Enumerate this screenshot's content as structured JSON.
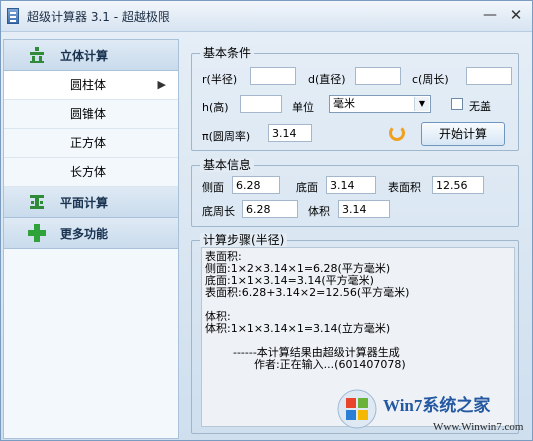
{
  "window": {
    "title": "超级计算器 3.1 - 超越极限",
    "minimize_label": "—",
    "close_label": "✕"
  },
  "sidebar": {
    "sections": [
      {
        "label": "立体计算",
        "icon": "solid-geometry-icon"
      },
      {
        "label": "平面计算",
        "icon": "plane-geometry-icon"
      },
      {
        "label": "更多功能",
        "icon": "plus-icon"
      }
    ],
    "items": [
      {
        "label": "圆柱体",
        "arrow": "▶"
      },
      {
        "label": "圆锥体"
      },
      {
        "label": "正方体"
      },
      {
        "label": "长方体"
      }
    ]
  },
  "basic_conditions": {
    "title": "基本条件",
    "radius_label": "r(半径)",
    "radius_value": "",
    "diameter_label": "d(直径)",
    "diameter_value": "",
    "circumference_label": "c(周长)",
    "circumference_value": "",
    "height_label": "h(高)",
    "height_value": "",
    "unit_label": "单位",
    "unit_value": "毫米",
    "no_lid_label": "无盖",
    "no_lid_checked": false,
    "pi_label": "π(圆周率)",
    "pi_value": "3.14",
    "start_button": "开始计算"
  },
  "basic_info": {
    "title": "基本信息",
    "side_label": "侧面",
    "side_value": "6.28",
    "base_label": "底面",
    "base_value": "3.14",
    "surface_label": "表面积",
    "surface_value": "12.56",
    "base_perimeter_label": "底周长",
    "base_perimeter_value": "6.28",
    "volume_label": "体积",
    "volume_value": "3.14"
  },
  "steps": {
    "title": "计算步骤(半径)",
    "lines": [
      "表面积:",
      "侧面:1×2×3.14×1=6.28(平方毫米)",
      "底面:1×1×3.14=3.14(平方毫米)",
      "表面积:6.28+3.14×2=12.56(平方毫米)",
      "",
      "体积:",
      "体积:1×1×3.14×1=3.14(立方毫米)",
      "",
      "        ------本计算结果由超级计算器生成",
      "              作者:正在输入...(601407078)"
    ]
  },
  "watermark": {
    "brand": "Win7系统之家",
    "url": "Www.Winwin7.com"
  }
}
